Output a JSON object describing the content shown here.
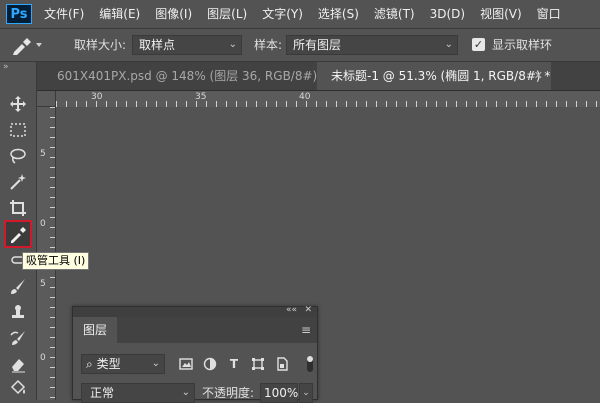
{
  "app": {
    "logo": "Ps"
  },
  "menu": {
    "items": [
      {
        "label": "文件(F)"
      },
      {
        "label": "编辑(E)"
      },
      {
        "label": "图像(I)"
      },
      {
        "label": "图层(L)"
      },
      {
        "label": "文字(Y)"
      },
      {
        "label": "选择(S)"
      },
      {
        "label": "滤镜(T)"
      },
      {
        "label": "3D(D)"
      },
      {
        "label": "视图(V)"
      },
      {
        "label": "窗口"
      }
    ]
  },
  "options": {
    "sample_size_label": "取样大小:",
    "sample_size_value": "取样点",
    "sample_label": "样本:",
    "sample_value": "所有图层",
    "show_ring_label": "显示取样环",
    "show_ring_checked": true
  },
  "tabs": [
    {
      "label": "601X401PX.psd @ 148% (图层 36, RGB/8#) *",
      "active": false
    },
    {
      "label": "未标题-1 @ 51.3% (椭圆 1, RGB/8#) *",
      "active": true
    }
  ],
  "ruler": {
    "h_labels": [
      "30",
      "35",
      "40"
    ],
    "v_labels": [
      "5",
      "0",
      "5",
      "0"
    ]
  },
  "toolbar": {
    "tools": [
      {
        "icon": "move-icon"
      },
      {
        "icon": "marquee-icon"
      },
      {
        "icon": "lasso-icon"
      },
      {
        "icon": "magic-wand-icon"
      },
      {
        "icon": "crop-icon"
      },
      {
        "icon": "eyedropper-icon",
        "active": true
      },
      {
        "icon": "healing-icon"
      },
      {
        "icon": "brush-icon"
      },
      {
        "icon": "stamp-icon"
      },
      {
        "icon": "history-brush-icon"
      },
      {
        "icon": "eraser-icon"
      },
      {
        "icon": "paint-bucket-icon"
      }
    ],
    "tooltip": "吸管工具 (I)"
  },
  "layers_panel": {
    "tab_label": "图层",
    "filter_label": "类型",
    "blend_mode": "正常",
    "opacity_label": "不透明度:",
    "opacity_value": "100%"
  },
  "colors": {
    "accent": "#31a8ff",
    "highlight": "#d0192b",
    "panel": "#535353"
  }
}
